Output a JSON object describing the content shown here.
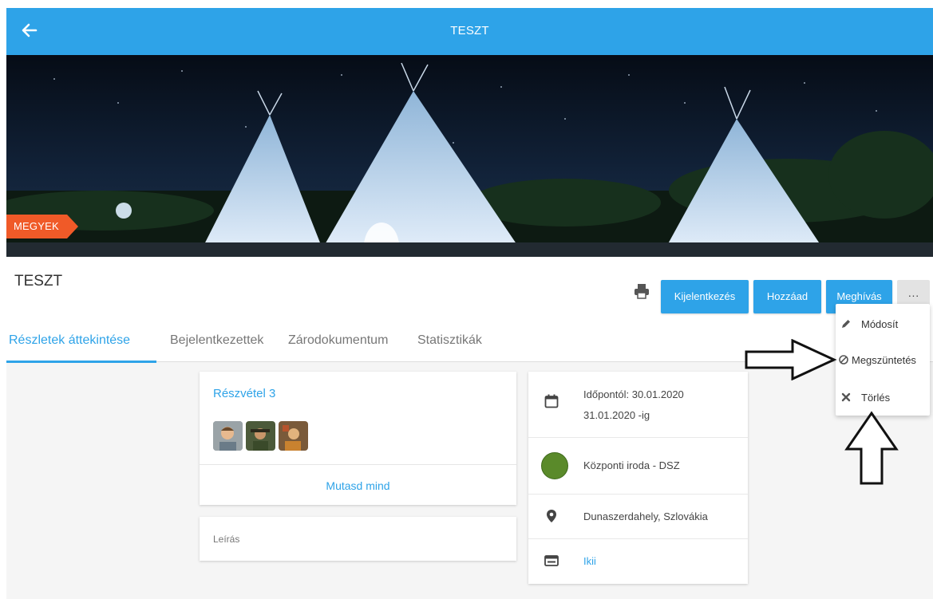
{
  "topbar": {
    "title": "TESZT",
    "back_icon": "arrow-left-icon"
  },
  "banner": {
    "going_badge": "MEGYEK"
  },
  "header": {
    "title": "TESZT",
    "actions": {
      "logout": "Kijelentkezés",
      "add": "Hozzáad",
      "invite": "Meghívás",
      "more": "···"
    }
  },
  "tabs": [
    {
      "label": "Részletek áttekintése",
      "active": true
    },
    {
      "label": "Bejelentkezettek",
      "active": false
    },
    {
      "label": "Zárodokumentum",
      "active": false
    },
    {
      "label": "Statisztikák",
      "active": false
    }
  ],
  "participation": {
    "title": "Részvétel",
    "count": "3",
    "show_all": "Mutasd mind"
  },
  "description": {
    "label": "Leírás"
  },
  "details": {
    "date_line1": "Időpontól: 30.01.2020",
    "date_line2": "31.01.2020 -ig",
    "organizer": "Központi iroda - DSZ",
    "location": "Dunaszerdahely, Szlovákia",
    "link": "Ikii",
    "organizer_color": "#5a8a2a"
  },
  "menu": {
    "edit": "Módosít",
    "cancel": "Megszüntetés",
    "delete": "Törlés"
  },
  "colors": {
    "accent": "#2ea3e8",
    "badge": "#f05a28"
  }
}
